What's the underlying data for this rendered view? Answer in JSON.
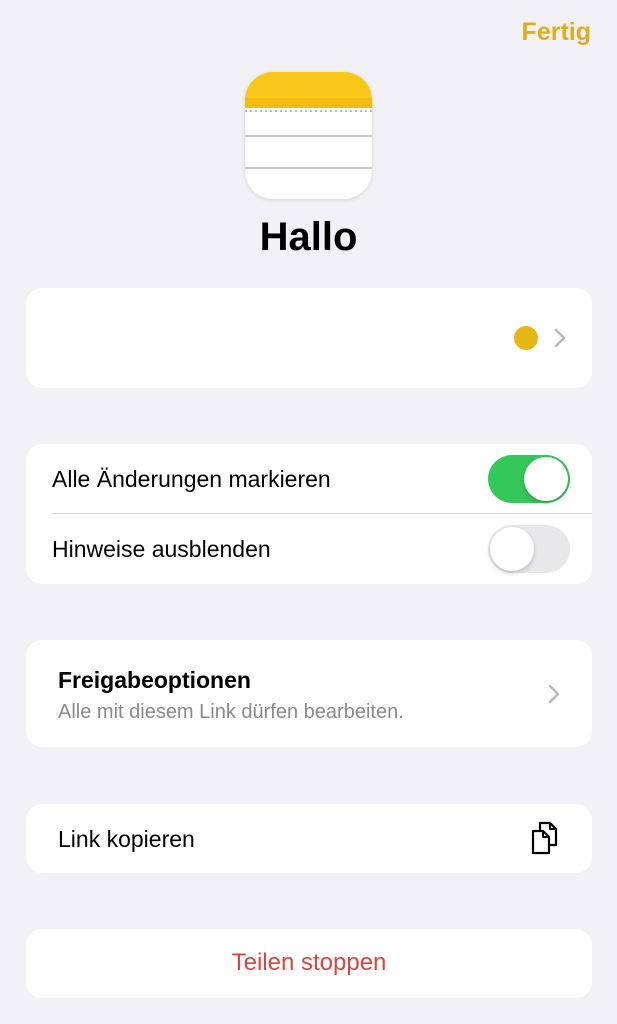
{
  "header": {
    "done_label": "Fertig"
  },
  "note": {
    "title": "Hallo"
  },
  "colors": {
    "accent": "#dfad1d",
    "highlight_color_dot": "#e6b816",
    "toggle_on": "#35c759",
    "destructive": "#d8473f"
  },
  "settings": {
    "highlight_all_changes": {
      "label": "Alle Änderungen markieren",
      "enabled": true
    },
    "hide_alerts": {
      "label": "Hinweise ausblenden",
      "enabled": false
    }
  },
  "share_options": {
    "title": "Freigabeoptionen",
    "subtitle": "Alle mit diesem Link dürfen bearbeiten."
  },
  "copy_link": {
    "label": "Link kopieren",
    "icon": "copy-document-icon"
  },
  "stop_sharing": {
    "label": "Teilen stoppen"
  }
}
